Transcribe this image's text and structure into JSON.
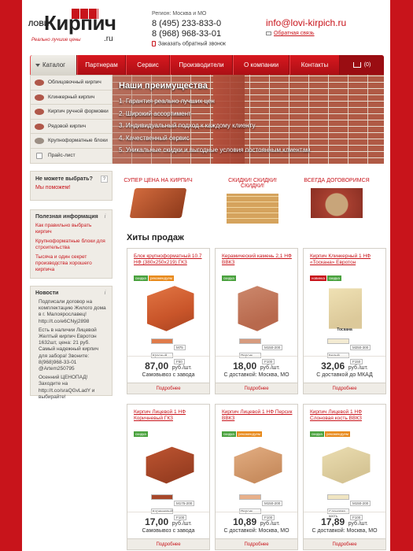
{
  "header": {
    "logo_prefix": "ЛОВИ",
    "logo_main": "Кирпич",
    "logo_domain": ".ru",
    "logo_tagline": "Реально лучшие цены",
    "region": "Регион: Москва и МО",
    "phone1": "8 (495) 233-833-0",
    "phone2": "8 (968) 968-33-01",
    "callback": "Заказать обратный звонок",
    "email": "info@lovi-kirpich.ru",
    "feedback": "Обратная связь"
  },
  "nav": {
    "items": [
      "Каталог",
      "Партнерам",
      "Сервис",
      "Производители",
      "О компании",
      "Контакты"
    ],
    "cart": "(0)"
  },
  "catalog_menu": [
    "Облицовочный кирпич",
    "Клинкерный кирпич",
    "Кирпич ручной формовки",
    "Рядовой кирпич",
    "Крупноформатные блоки",
    "Прайс-лист"
  ],
  "banner": {
    "title": "Наши преимущества",
    "items": [
      "1. Гарантия реально лучших цен",
      "2. Широкий ассортимент",
      "3. Индивидуальный подход к каждому клиенту",
      "4. Качественный сервис",
      "5. Уникальные скидки и выгодные условия постоянным клиентам"
    ]
  },
  "help": {
    "question": "Не можете выбрать?",
    "link": "Мы поможем!",
    "badge": "?"
  },
  "info": {
    "title": "Полезная информация",
    "badge": "i",
    "links": [
      "Как правильно выбрать кирпич",
      "Крупноформатные блоки для строительства",
      "Тысяча и один секрет производства хорошего кирпича"
    ]
  },
  "news": {
    "title": "Новости",
    "badge": "i",
    "items": [
      "Подписали договор на комплектацию Жилого дома в г. Малоярославец! http://t.co/e6CNyj2898",
      "Есть в наличии Лицевой Желтый кирпич Евротон 1632шт, цена: 21 руб. Самый надежный кирпич для забора! Звоните: 8(968)968-33-01 @Artem250795",
      "Осенний ЦЕНОПАД! Заходите на http://t.co/sraQGvLadY и выбирайте!"
    ]
  },
  "promos": [
    "СУПЕР ЦЕНА НА КИРПИЧ",
    "СКИДКИ! СКИДКИ! СКИДКИ!",
    "ВСЕГДА ДОГОВОРИМСЯ"
  ],
  "hits_title": "Хиты продаж",
  "products": [
    {
      "name": "Блок крупноформатный 10.7 НФ (380х250х219) ГКЗ",
      "tags": [
        "скидка",
        "рекомендуем"
      ],
      "swatch": "Красный",
      "marks": [
        "М75",
        "F50"
      ],
      "price": "87,00",
      "unit": "руб./шт.",
      "delivery": "Самовывоз с завода",
      "more": "Подробнее"
    },
    {
      "name": "Керамический камень 2,1 НФ ВВКЗ",
      "tags": [
        "скидка"
      ],
      "swatch": "Персик",
      "marks": [
        "М150-200",
        "F100"
      ],
      "price": "18,00",
      "unit": "руб./шт.",
      "delivery": "С доставкой: Москва, МО",
      "more": "Подробнее"
    },
    {
      "name": "Кирпич Клинкерный 1 НФ «Тоскана» Евротон",
      "tags": [
        "новинка",
        "скидка"
      ],
      "swatch": "Белый",
      "marks": [
        "М250-300",
        "F150"
      ],
      "label": "Тоскана",
      "price": "32,06",
      "unit": "руб./шт.",
      "delivery": "С доставкой до МКАД",
      "more": "Подробнее"
    },
    {
      "name": "Кирпич Лицевой 1 НФ Коричневый ГКЗ",
      "tags": [
        "скидка"
      ],
      "swatch": "Коричневый",
      "marks": [
        "М175-200",
        "F100"
      ],
      "price": "17,00",
      "unit": "руб./шт.",
      "delivery": "Самовывоз с завода",
      "more": "Подробнее"
    },
    {
      "name": "Кирпич Лицевой 1 НФ Персик ВВКЗ",
      "tags": [
        "скидка",
        "рекомендуем"
      ],
      "swatch": "Персик",
      "marks": [
        "М150-200",
        "F100"
      ],
      "price": "10,89",
      "unit": "руб./шт.",
      "delivery": "С доставкой: Москва, МО",
      "more": "Подробнее"
    },
    {
      "name": "Кирпич Лицевой 1 НФ Слоновая кость ВВКЗ",
      "tags": [
        "скидка",
        "рекомендуем"
      ],
      "swatch": "Слоновая кость",
      "marks": [
        "М150-200",
        "F100"
      ],
      "price": "17,89",
      "unit": "руб./шт.",
      "delivery": "С доставкой: Москва, МО",
      "more": "Подробнее"
    }
  ]
}
